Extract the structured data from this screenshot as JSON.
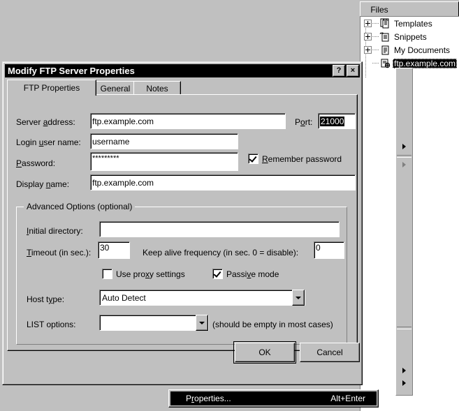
{
  "dialog": {
    "title": "Modify FTP Server Properties",
    "help_button": "?",
    "close_button": "×",
    "tabs": [
      {
        "label": "FTP Properties",
        "active": true
      },
      {
        "label": "General",
        "active": false
      },
      {
        "label": "Notes",
        "active": false
      }
    ],
    "fields": {
      "server_address": {
        "label": "Server address:",
        "value": "ftp.example.com"
      },
      "port": {
        "label": "Port:",
        "value": "21000",
        "selected": true
      },
      "login_user_name": {
        "label": "Login user name:",
        "value": "username"
      },
      "password": {
        "label": "Password:",
        "value": "*********"
      },
      "remember_password": {
        "label": "Remember password",
        "checked": true
      },
      "display_name": {
        "label": "Display name:",
        "value": "ftp.example.com"
      }
    },
    "advanced": {
      "group_title": "Advanced Options  (optional)",
      "initial_directory": {
        "label": "Initial directory:",
        "value": ""
      },
      "timeout": {
        "label": "Timeout (in sec.):",
        "value": "30"
      },
      "keep_alive": {
        "label": "Keep alive frequency (in sec. 0 = disable):",
        "value": "0"
      },
      "use_proxy": {
        "label": "Use proxy settings",
        "checked": false
      },
      "passive_mode": {
        "label": "Passive mode",
        "checked": true
      },
      "host_type": {
        "label": "Host type:",
        "value": "Auto Detect"
      },
      "list_options": {
        "label": "LIST options:",
        "value": "",
        "hint": "(should be empty in most cases)"
      }
    },
    "buttons": {
      "ok": "OK",
      "cancel": "Cancel"
    }
  },
  "files_panel": {
    "tab_label": "Files",
    "tree": [
      {
        "label": "Templates",
        "icon": "documents-stack-icon",
        "expandable": true,
        "selected": false
      },
      {
        "label": "Snippets",
        "icon": "document-arrow-icon",
        "expandable": true,
        "selected": false
      },
      {
        "label": "My Documents",
        "icon": "document-icon",
        "expandable": true,
        "selected": false
      },
      {
        "label": "ftp.example.com",
        "icon": "ftp-server-icon",
        "expandable": false,
        "selected": true
      }
    ]
  },
  "context_menu": {
    "item_label": "Properties...",
    "accelerator": "Alt+Enter"
  },
  "colors": {
    "face": "#c0c0c0",
    "titlebar": "#000000",
    "highlight": "#000000",
    "window": "#ffffff"
  }
}
